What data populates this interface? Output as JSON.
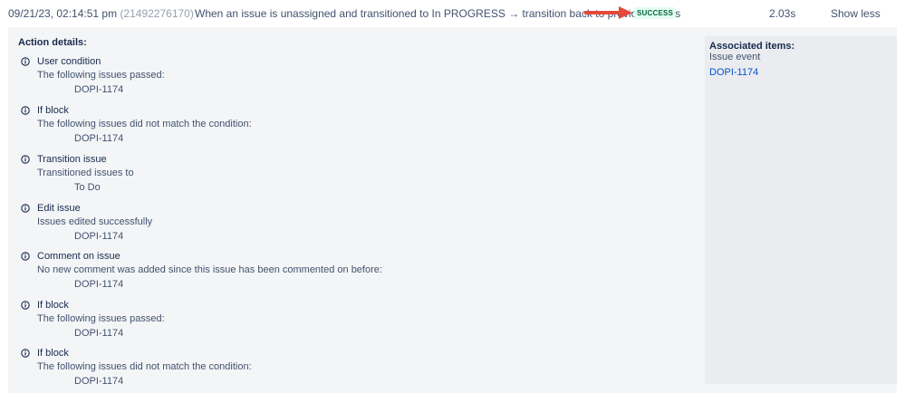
{
  "header": {
    "timestamp": "09/21/23, 02:14:51 pm",
    "execution_id": "(21492276170)",
    "rule_description": "When an issue is unassigned and transitioned to In PROGRESS → transition back to previous status",
    "status": "SUCCESS",
    "duration": "2.03s",
    "toggle_label": "Show less",
    "arrow_color": "#e5493a"
  },
  "details": {
    "title": "Action details:",
    "icon": "info-icon",
    "actions": [
      {
        "title": "User condition",
        "description": "The following issues passed:",
        "value": "DOPI-1174"
      },
      {
        "title": "If block",
        "description": "The following issues did not match the condition:",
        "value": "DOPI-1174"
      },
      {
        "title": "Transition issue",
        "description": "Transitioned issues to",
        "value": "To Do"
      },
      {
        "title": "Edit issue",
        "description": "Issues edited successfully",
        "value": "DOPI-1174"
      },
      {
        "title": "Comment on issue",
        "description": "No new comment was added since this issue has been commented on before:",
        "value": "DOPI-1174"
      },
      {
        "title": "If block",
        "description": "The following issues passed:",
        "value": "DOPI-1174"
      },
      {
        "title": "If block",
        "description": "The following issues did not match the condition:",
        "value": "DOPI-1174"
      }
    ]
  },
  "associated": {
    "title": "Associated items:",
    "subtitle": "Issue event",
    "link": "DOPI-1174"
  }
}
